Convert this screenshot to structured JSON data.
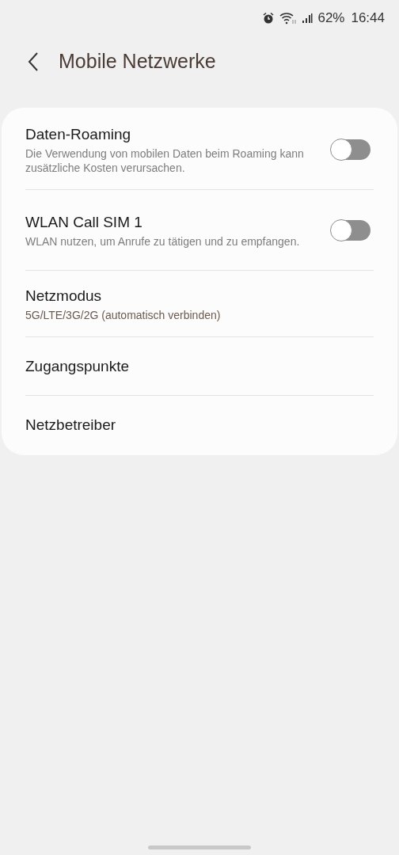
{
  "status_bar": {
    "battery": "62%",
    "time": "16:44"
  },
  "header": {
    "title": "Mobile Netzwerke"
  },
  "items": [
    {
      "kind": "toggle",
      "title": "Daten-Roaming",
      "subtitle": "Die Verwendung von mobilen Daten beim Roaming kann zusätzliche Kosten verursachen.",
      "on": false
    },
    {
      "kind": "toggle",
      "title": "WLAN Call SIM 1",
      "subtitle": "WLAN nutzen, um Anrufe zu tätigen und zu empfangen.",
      "on": false
    },
    {
      "kind": "value",
      "title": "Netzmodus",
      "subtitle": "5G/LTE/3G/2G (automatisch verbinden)"
    },
    {
      "kind": "plain",
      "title": "Zugangspunkte"
    },
    {
      "kind": "plain",
      "title": "Netzbetreiber"
    }
  ]
}
